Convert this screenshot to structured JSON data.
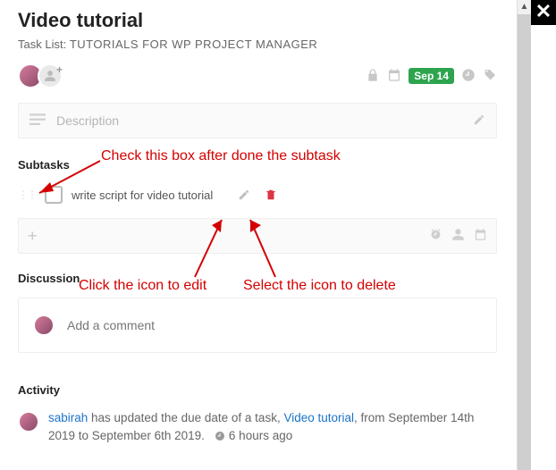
{
  "header": {
    "title": "Video tutorial",
    "tasklist_label": "Task List:",
    "tasklist_name": "TUTORIALS FOR WP PROJECT MANAGER",
    "due_badge": "Sep 14"
  },
  "description": {
    "placeholder": "Description"
  },
  "subtasks": {
    "heading": "Subtasks",
    "items": [
      {
        "text": "write script for video tutorial",
        "checked": false
      }
    ],
    "new_placeholder": ""
  },
  "discussion": {
    "heading": "Discussion",
    "comment_placeholder": "Add a comment"
  },
  "activity": {
    "heading": "Activity",
    "items": [
      {
        "user": "sabirah",
        "text_1": " has updated the due date of a task, ",
        "task_link": "Video tutorial",
        "text_2": ", from September 14th 2019 to September 6th 2019.",
        "ago": "6 hours ago"
      }
    ]
  },
  "annotations": {
    "check": "Check this box after done the subtask",
    "edit": "Click the icon to edit",
    "delete": "Select the icon to delete"
  }
}
